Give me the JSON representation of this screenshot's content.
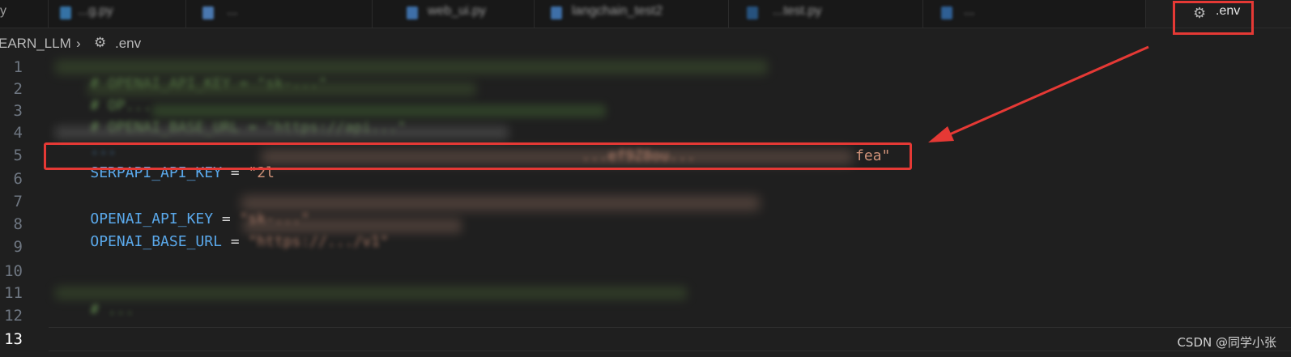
{
  "tabs": [
    {
      "label": "y"
    },
    {
      "label": "...g.py"
    },
    {
      "label": "..."
    },
    {
      "label": "web_ui.py"
    },
    {
      "label": "langchain_test2"
    },
    {
      "label": "...test.py"
    },
    {
      "label": "..."
    },
    {
      "label": ".env",
      "active": true,
      "icon": "gear-icon"
    }
  ],
  "breadcrumb": {
    "folder": "EARN_LLM",
    "separator": "›",
    "file": ".env",
    "icon": "gear-icon"
  },
  "editor": {
    "line_numbers": [
      "1",
      "2",
      "3",
      "4",
      "5",
      "6",
      "7",
      "8",
      "9",
      "10",
      "11",
      "12",
      "13"
    ],
    "current_line": "13",
    "lines": {
      "line1": "# OPENAI_API_KEY = \"sk-...\"",
      "line2": "# OP...",
      "line3_comment": "# OPENAI_BASE_URL = \"https://api...\"",
      "line4": "...",
      "line5_key": "SERPAPI_API_KEY",
      "line5_eq": " = ",
      "line5_val_start": "\"2l",
      "line5_val_mid": "...ef9Z8ou...",
      "line5_val_end": "fea\"",
      "line7_key": "OPENAI_API_KEY",
      "line7_eq": " = ",
      "line7_val": "\"sk-...\"",
      "line8_key": "OPENAI_BASE_URL",
      "line8_eq": " = ",
      "line8_val": "\"https://.../v1\"",
      "line11": "# ..."
    }
  },
  "watermark": "CSDN @同学小张",
  "colors": {
    "annotation": "#e53935",
    "key": "#5aa8ea",
    "string": "#ce9178",
    "comment": "#6a9955"
  }
}
